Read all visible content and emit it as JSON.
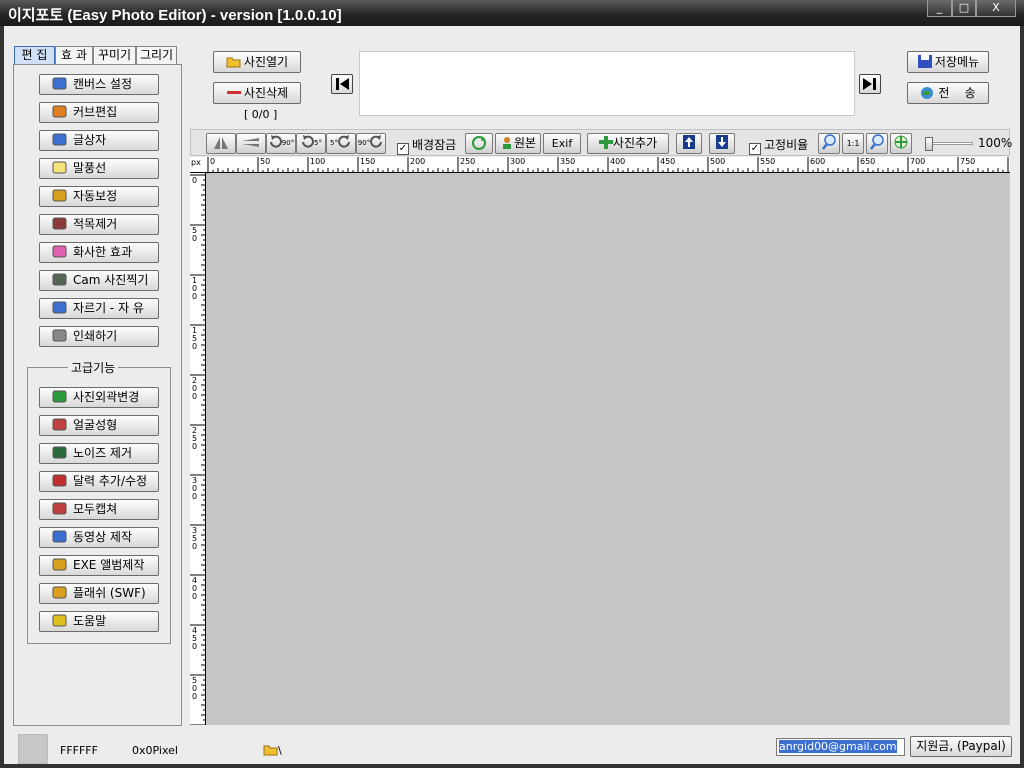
{
  "window": {
    "title": "이지포토 (Easy Photo Editor) - version [1.0.0.10]",
    "minimize": "_",
    "maximize": "□",
    "close": "X"
  },
  "tabs": [
    {
      "label": "편 집",
      "active": true
    },
    {
      "label": "효 과"
    },
    {
      "label": "꾸미기"
    },
    {
      "label": "그리기"
    }
  ],
  "sidebar": {
    "items": [
      {
        "label": "캔버스 설정",
        "icon": "canvas-icon",
        "color": "#3b6fd1"
      },
      {
        "label": "커브편집",
        "icon": "chart-icon",
        "color": "#e08020"
      },
      {
        "label": "글상자",
        "icon": "text-box-icon",
        "color": "#3b6fd1"
      },
      {
        "label": "말풍선",
        "icon": "speech-bubble-icon",
        "color": "#f5e27a"
      },
      {
        "label": "자동보정",
        "icon": "magic-wand-icon",
        "color": "#d9a020"
      },
      {
        "label": "적목제거",
        "icon": "red-eye-icon",
        "color": "#8b3a3a"
      },
      {
        "label": "화사한 효과",
        "icon": "glow-icon",
        "color": "#e060b0"
      },
      {
        "label": "Cam 사진찍기",
        "icon": "camera-icon",
        "color": "#556655"
      },
      {
        "label": "자르기 - 자 유",
        "icon": "crop-icon",
        "color": "#3b6fd1"
      },
      {
        "label": "인쇄하기",
        "icon": "printer-icon",
        "color": "#888888"
      }
    ],
    "advanced_title": "고급기능",
    "advanced": [
      {
        "label": "사진외곽변경",
        "icon": "shapes-icon",
        "color": "#2a9a3a"
      },
      {
        "label": "얼굴성형",
        "icon": "face-icon",
        "color": "#c04040"
      },
      {
        "label": "노이즈 제거",
        "icon": "landscape-icon",
        "color": "#2a6a3a"
      },
      {
        "label": "달력 추가/수정",
        "icon": "calendar-icon",
        "color": "#c03030"
      },
      {
        "label": "모두캡쳐",
        "icon": "portrait-icon",
        "color": "#c04040"
      },
      {
        "label": "동영상 제작",
        "icon": "film-icon",
        "color": "#3b6fd1"
      },
      {
        "label": "EXE 앨범제작",
        "icon": "magic-wand-icon",
        "color": "#d9a020"
      },
      {
        "label": "플래쉬 (SWF)",
        "icon": "magic-wand-icon",
        "color": "#d9a020"
      },
      {
        "label": "도움말",
        "icon": "help-icon",
        "color": "#e0c020"
      }
    ]
  },
  "file_buttons": {
    "open": "사진열기",
    "delete": "사진삭제",
    "counter": "[ 0/0 ]"
  },
  "right_buttons": {
    "save_menu": "저장메뉴",
    "send": "전    송"
  },
  "toolbar": {
    "lock_bg": "배경잠금",
    "original": "원본",
    "exif": "Exif",
    "add_photo": "사진추가",
    "fixed_ratio": "고정비율",
    "actual_size": "1:1",
    "rotate_90_ccw": "90°",
    "rotate_5_ccw": "5°",
    "rotate_5_cw": "5°",
    "rotate_90_cw": "90°",
    "zoom_percent": "100%"
  },
  "ruler": {
    "unit": "px",
    "h_labels": [
      "0",
      "50",
      "100",
      "150",
      "200",
      "250",
      "300",
      "350",
      "400",
      "450",
      "500",
      "550",
      "600",
      "650",
      "700",
      "750"
    ],
    "v_labels": [
      "0",
      "50",
      "100",
      "150",
      "200",
      "250",
      "300",
      "350",
      "400",
      "450",
      "500"
    ]
  },
  "status": {
    "color_hex": "FFFFFF",
    "size": "0x0Pixel",
    "path": "\\",
    "email": "anrgid00@gmail.com",
    "donate": "지원금, (Paypal)"
  }
}
